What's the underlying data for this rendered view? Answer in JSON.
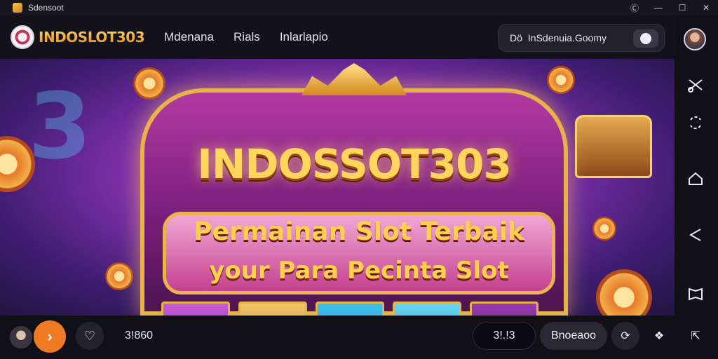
{
  "window": {
    "title": "Sdensoot",
    "controls": [
      "help",
      "minimize",
      "maximize",
      "close"
    ]
  },
  "header": {
    "brand": "INDOSLOT303",
    "nav": [
      "Mdenana",
      "Rials",
      "Inlarlapio"
    ],
    "search_prefix": "Dö",
    "search_text": "InSdenuia.Goomy"
  },
  "hero": {
    "background_digit": "3",
    "headline": "INDOSSOT303",
    "tagline_1": "Permainan Slot Terbaik",
    "tagline_2": "your Para Pecinta Slot"
  },
  "sidebar": {
    "icons": [
      "user-avatar",
      "scissors-icon",
      "loop-icon",
      "home-icon",
      "share-icon",
      "book-icon"
    ]
  },
  "bottombar": {
    "count": "3!860",
    "pill_dark": "3!.!3",
    "pill_mid": "Bnoeaoo",
    "play_label": "›",
    "accent": "#f07a22"
  }
}
